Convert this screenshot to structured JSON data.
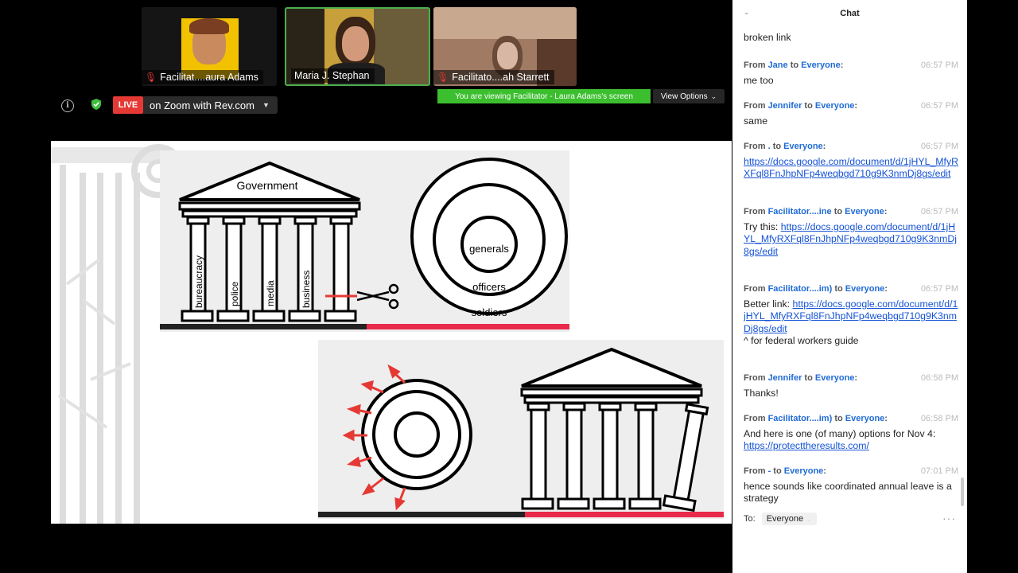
{
  "participants": [
    {
      "name": "Facilitat....aura Adams",
      "muted": true
    },
    {
      "name": "Maria J. Stephan",
      "muted": false
    },
    {
      "name": "Facilitato....ah Starrett",
      "muted": true
    }
  ],
  "toolbar": {
    "live_badge": "LIVE",
    "live_label": "on Zoom with Rev.com",
    "viewing_banner": "You are viewing Facilitator - Laura Adams's screen",
    "view_options": "View Options"
  },
  "slide": {
    "government": "Government",
    "pillars": [
      "bureaucracy",
      "police",
      "media",
      "business"
    ],
    "rings": [
      "generals",
      "officers",
      "soldiers"
    ]
  },
  "chat": {
    "title": "Chat",
    "messages": [
      {
        "body": "broken link"
      },
      {
        "from": "Jane",
        "to": "Everyone",
        "time": "06:57 PM",
        "body": "me too"
      },
      {
        "from": "Jennifer",
        "to": "Everyone",
        "time": "06:57 PM",
        "body": "same"
      },
      {
        "from": ".",
        "to": "Everyone",
        "time": "06:57 PM",
        "link": "https://docs.google.com/document/d/1jHYL_MfyRXFql8FnJhpNFp4weqbgd710g9K3nmDj8gs/edit"
      },
      {
        "from": "Facilitator....ine",
        "to": "Everyone",
        "time": "06:57 PM",
        "body": "Try this: ",
        "link": "https://docs.google.com/document/d/1jHYL_MfyRXFql8FnJhpNFp4weqbgd710g9K3nmDj8gs/edit"
      },
      {
        "from": "Facilitator....im)",
        "to": "Everyone",
        "time": "06:57 PM",
        "body": "Better link: ",
        "link": "https://docs.google.com/document/d/1jHYL_MfyRXFql8FnJhpNFp4weqbgd710g9K3nmDj8gs/edit",
        "after": "^ for federal workers guide"
      },
      {
        "from": "Jennifer",
        "to": "Everyone",
        "time": "06:58 PM",
        "body": "Thanks!"
      },
      {
        "from": "Facilitator....im)",
        "to": "Everyone",
        "time": "06:58 PM",
        "body": "And here is one (of many) options for Nov 4: ",
        "link": "https://protecttheresults.com/"
      },
      {
        "from": "-",
        "to": "Everyone",
        "time": "07:01 PM",
        "body": "hence sounds like coordinated annual leave is a strategy"
      }
    ],
    "from_word": "From",
    "to_word": "to",
    "to_label": "To:",
    "to_value": "Everyone"
  }
}
